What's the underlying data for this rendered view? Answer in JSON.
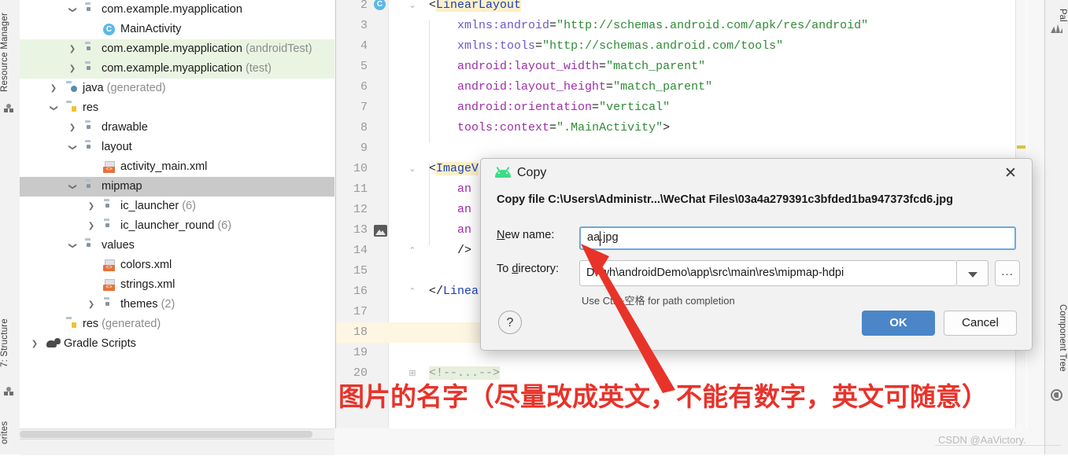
{
  "left_tabs": [
    {
      "label": "Resource Manager",
      "icon": "palette-icon"
    },
    {
      "label": "7: Structure",
      "icon": "structure-icon"
    },
    {
      "label": "orites",
      "icon": "favorites-icon"
    }
  ],
  "right_tabs": [
    {
      "label": "Pal",
      "icon": "palette-icon"
    },
    {
      "label": "Component Tree",
      "icon": "component-tree-icon"
    }
  ],
  "project_tree": [
    {
      "indent": 2,
      "arrow": "open",
      "icon": "folder",
      "label": "com.example.myapplication",
      "suffix": "",
      "state": "normal"
    },
    {
      "indent": 3,
      "arrow": "none",
      "icon": "class",
      "label": "MainActivity",
      "suffix": "",
      "state": "normal"
    },
    {
      "indent": 2,
      "arrow": "closed",
      "icon": "folder",
      "label": "com.example.myapplication",
      "suffix": " (androidTest)",
      "state": "green"
    },
    {
      "indent": 2,
      "arrow": "closed",
      "icon": "folder",
      "label": "com.example.myapplication",
      "suffix": " (test)",
      "state": "green"
    },
    {
      "indent": 1,
      "arrow": "closed",
      "icon": "java",
      "label": "java",
      "suffix": " (generated)",
      "state": "normal"
    },
    {
      "indent": 1,
      "arrow": "open",
      "icon": "resf",
      "label": "res",
      "suffix": "",
      "state": "normal"
    },
    {
      "indent": 2,
      "arrow": "closed",
      "icon": "folder",
      "label": "drawable",
      "suffix": "",
      "state": "normal"
    },
    {
      "indent": 2,
      "arrow": "open",
      "icon": "folder",
      "label": "layout",
      "suffix": "",
      "state": "normal"
    },
    {
      "indent": 3,
      "arrow": "none",
      "icon": "xml",
      "label": "activity_main.xml",
      "suffix": "",
      "state": "normal"
    },
    {
      "indent": 2,
      "arrow": "open",
      "icon": "folder",
      "label": "mipmap",
      "suffix": "",
      "state": "selected"
    },
    {
      "indent": 3,
      "arrow": "closed",
      "icon": "folder",
      "label": "ic_launcher",
      "suffix": " (6)",
      "state": "normal"
    },
    {
      "indent": 3,
      "arrow": "closed",
      "icon": "folder",
      "label": "ic_launcher_round",
      "suffix": " (6)",
      "state": "normal"
    },
    {
      "indent": 2,
      "arrow": "open",
      "icon": "folder",
      "label": "values",
      "suffix": "",
      "state": "normal"
    },
    {
      "indent": 3,
      "arrow": "none",
      "icon": "xml",
      "label": "colors.xml",
      "suffix": "",
      "state": "normal"
    },
    {
      "indent": 3,
      "arrow": "none",
      "icon": "xml",
      "label": "strings.xml",
      "suffix": "",
      "state": "normal"
    },
    {
      "indent": 3,
      "arrow": "closed",
      "icon": "folder",
      "label": "themes",
      "suffix": " (2)",
      "state": "normal"
    },
    {
      "indent": 1,
      "arrow": "none",
      "icon": "resf",
      "label": "res",
      "suffix": " (generated)",
      "state": "normal"
    },
    {
      "indent": 0,
      "arrow": "closed",
      "icon": "gradle",
      "label": "Gradle Scripts",
      "suffix": "",
      "state": "normal"
    }
  ],
  "editor": {
    "lines": [
      {
        "num": "2",
        "indent": 0,
        "html": "<span class='punct'>&lt;</span><span class='tagn brace-hl'>LinearLayout</span>"
      },
      {
        "num": "3",
        "indent": 0,
        "html": "    <span class='ns'>xmlns:android</span><span class='punct'>=</span><span class='str'>\"http://schemas.android.com/apk/res/android\"</span>"
      },
      {
        "num": "4",
        "indent": 0,
        "html": "    <span class='ns'>xmlns:tools</span><span class='punct'>=</span><span class='str'>\"http://schemas.android.com/tools\"</span>"
      },
      {
        "num": "5",
        "indent": 0,
        "html": "    <span class='attr'>android:layout_width</span><span class='punct'>=</span><span class='str'>\"match_parent\"</span>"
      },
      {
        "num": "6",
        "indent": 0,
        "html": "    <span class='attr'>android:layout_height</span><span class='punct'>=</span><span class='str'>\"match_parent\"</span>"
      },
      {
        "num": "7",
        "indent": 0,
        "html": "    <span class='attr'>android:orientation</span><span class='punct'>=</span><span class='str'>\"vertical\"</span>"
      },
      {
        "num": "8",
        "indent": 0,
        "html": "    <span class='attr'>tools:context</span><span class='punct'>=</span><span class='str'>\".MainActivity\"</span><span class='punct'>&gt;</span>"
      },
      {
        "num": "9",
        "indent": 0,
        "html": ""
      },
      {
        "num": "10",
        "indent": 0,
        "html": "<span class='punct'>&lt;</span><span class='tagn brace-hl'>ImageV</span>"
      },
      {
        "num": "11",
        "indent": 0,
        "html": "    <span class='attr'>an</span>"
      },
      {
        "num": "12",
        "indent": 0,
        "html": "    <span class='attr'>an</span>"
      },
      {
        "num": "13",
        "indent": 0,
        "html": "    <span class='attr'>an</span>"
      },
      {
        "num": "14",
        "indent": 0,
        "html": "    <span class='punct'>/&gt;</span>"
      },
      {
        "num": "15",
        "indent": 0,
        "html": ""
      },
      {
        "num": "16",
        "indent": 0,
        "html": "<span class='punct'>&lt;/</span><span class='tagn'>LinearL</span>"
      },
      {
        "num": "17",
        "indent": 0,
        "html": ""
      },
      {
        "num": "18",
        "indent": 0,
        "html": ""
      },
      {
        "num": "19",
        "indent": 0,
        "html": ""
      },
      {
        "num": "20",
        "indent": 0,
        "html": "<span class='cmt cmtblk'>&lt;!--...--&gt;</span>"
      }
    ],
    "current_line": "18",
    "image_gutter_line": "13"
  },
  "dialog": {
    "title": "Copy",
    "title_icon": "android-icon",
    "close_icon": "close-icon",
    "message": "Copy file C:\\Users\\Administr...\\WeChat Files\\03a4a279391c3bfded1ba947373fcd6.jpg",
    "new_name_label": "New name:",
    "new_name_value": "aa.jpg",
    "to_directory_label": "To directory:",
    "to_directory_value": "D:\\wh\\androidDemo\\app\\src\\main\\res\\mipmap-hdpi",
    "dropdown_icon": "chevron-down-icon",
    "browse_label": "...",
    "hint": "Use Ctrl+空格 for path completion",
    "help_label": "?",
    "ok_label": "OK",
    "cancel_label": "Cancel",
    "accent_color": "#4a86c8",
    "focus_border_color": "#6fa8dc"
  },
  "annotation": {
    "text": "图片的名字（尽量改成英文，不能有数字，英文可随意）",
    "color": "#e8332a",
    "arrow_color": "#e8332a"
  },
  "watermark": {
    "text": "CSDN @AaVictory."
  }
}
